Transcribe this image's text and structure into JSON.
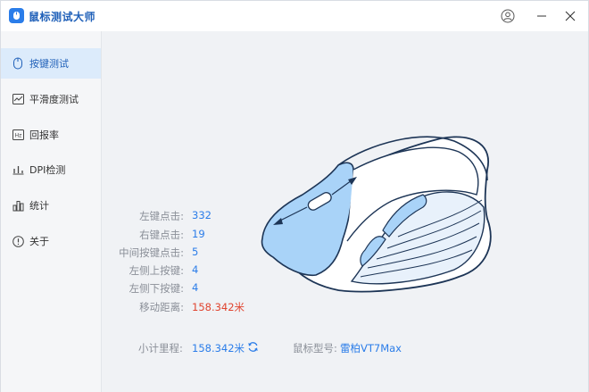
{
  "app": {
    "title": "鼠标测试大师"
  },
  "sidebar": {
    "items": [
      {
        "label": "按键测试",
        "icon": "mouse-icon",
        "active": true
      },
      {
        "label": "平滑度测试",
        "icon": "chart-line-icon",
        "active": false
      },
      {
        "label": "回报率",
        "icon": "hz-icon",
        "active": false
      },
      {
        "label": "DPI检测",
        "icon": "dpi-icon",
        "active": false
      },
      {
        "label": "统计",
        "icon": "bar-chart-icon",
        "active": false
      },
      {
        "label": "关于",
        "icon": "info-icon",
        "active": false
      }
    ]
  },
  "stats": [
    {
      "label": "左键点击:",
      "value": "332"
    },
    {
      "label": "右键点击:",
      "value": "19"
    },
    {
      "label": "中间按键点击:",
      "value": "5"
    },
    {
      "label": "左侧上按键:",
      "value": "4"
    },
    {
      "label": "左侧下按键:",
      "value": "4"
    },
    {
      "label": "移动距离:",
      "value": "158.342米"
    }
  ],
  "footer": {
    "subtotal_label": "小计里程:",
    "subtotal_value": "158.342米",
    "model_label": "鼠标型号:",
    "model_value": "雷柏VT7Max"
  },
  "colors": {
    "accent": "#2b7de9",
    "highlight": "#e0442f",
    "sidebar_active": "#dcebfb",
    "mouse_fill": "#a9d3f8"
  }
}
